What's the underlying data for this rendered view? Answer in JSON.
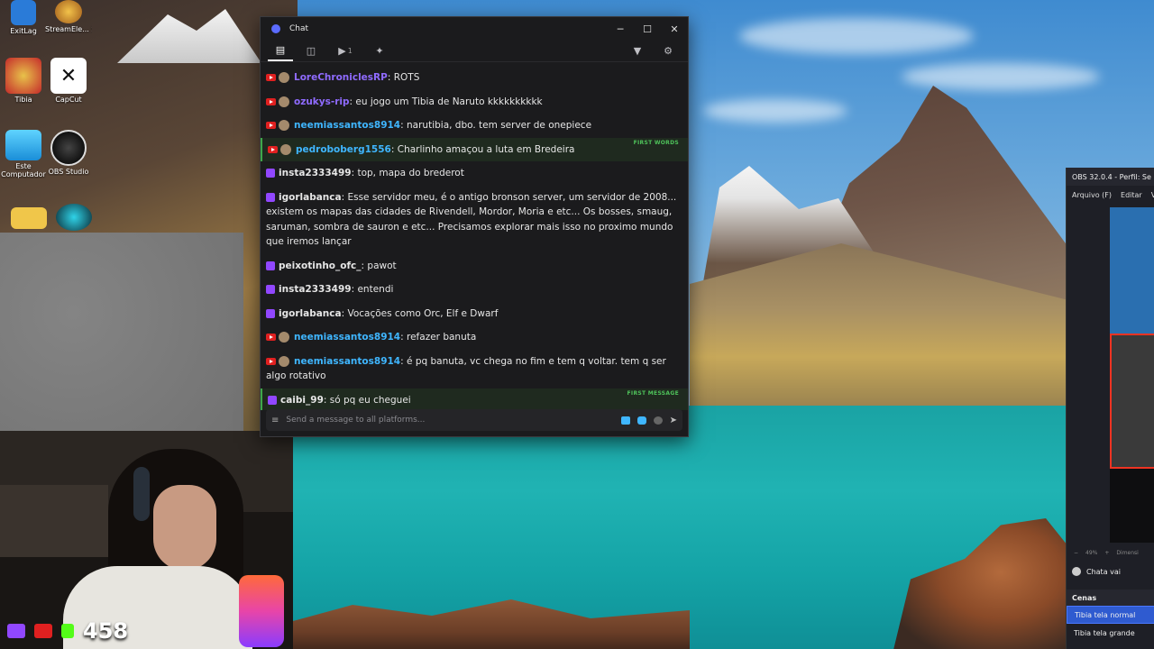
{
  "desktop": {
    "icons": [
      {
        "label": "ExitLag",
        "icon": "exitlag-icon",
        "color": "#2a7bd8"
      },
      {
        "label": "StreamEle... SE.Live",
        "icon": "streamelements-icon",
        "color": "#d88a2a"
      },
      {
        "label": "Tibia",
        "icon": "tibia-icon",
        "color": "#c7a33a"
      },
      {
        "label": "CapCut",
        "icon": "capcut-icon",
        "color": "#ffffff"
      },
      {
        "label": "Este Computador",
        "icon": "computer-icon",
        "color": "#2fb4e8"
      },
      {
        "label": "OBS Studio",
        "icon": "obs-icon",
        "color": "#2a2a2a"
      }
    ]
  },
  "webcam": {
    "viewer_count": "458"
  },
  "chat": {
    "title": "Chat",
    "toolbar": {
      "youtube_count": "1"
    },
    "messages": [
      {
        "platform": "youtube",
        "user": "LoreChroniclesRP",
        "sep": ":",
        "text": "ROTS",
        "color": "#8f6bff",
        "tag": ""
      },
      {
        "platform": "youtube",
        "user": "ozukys-rip",
        "sep": ":",
        "text": "eu jogo um Tibia de Naruto kkkkkkkkkk",
        "color": "#8f6bff",
        "tag": ""
      },
      {
        "platform": "youtube",
        "user": "neemiassantos8914",
        "sep": ":",
        "text": "narutibia, dbo. tem server de onepiece",
        "color": "#3fb6ff",
        "tag": ""
      },
      {
        "platform": "youtube",
        "user": "pedroboberg1556",
        "sep": ":",
        "text": "Charlinho amaçou a luta em Bredeira",
        "color": "#3fb6ff",
        "tag": "FIRST WORDS"
      },
      {
        "platform": "twitch",
        "user": "insta2333499",
        "sep": ":",
        "text": "top, mapa do brederot",
        "color": "#e6e6e6",
        "tag": ""
      },
      {
        "platform": "twitch",
        "user": "igorlabanca",
        "sep": ":",
        "text": "Esse servidor meu, é o antigo bronson server, um servidor de 2008... existem os mapas das cidades de Rivendell, Mordor, Moria e etc... Os bosses, smaug, saruman, sombra de sauron e etc... Precisamos explorar mais isso no proximo mundo que iremos lançar",
        "color": "#e6e6e6",
        "tag": ""
      },
      {
        "platform": "twitch",
        "user": "peixotinho_ofc_",
        "sep": ":",
        "text": "pawot",
        "color": "#e6e6e6",
        "tag": ""
      },
      {
        "platform": "twitch",
        "user": "insta2333499",
        "sep": ":",
        "text": "entendi",
        "color": "#e6e6e6",
        "tag": ""
      },
      {
        "platform": "twitch",
        "user": "igorlabanca",
        "sep": ":",
        "text": "Vocações como Orc, Elf e Dwarf",
        "color": "#e6e6e6",
        "tag": ""
      },
      {
        "platform": "youtube",
        "user": "neemiassantos8914",
        "sep": ":",
        "text": "refazer banuta",
        "color": "#3fb6ff",
        "tag": ""
      },
      {
        "platform": "youtube",
        "user": "neemiassantos8914",
        "sep": ":",
        "text": "é pq banuta, vc chega no fim e tem q voltar. tem q ser algo rotativo",
        "color": "#3fb6ff",
        "tag": ""
      },
      {
        "platform": "twitch",
        "user": "caibi_99",
        "sep": ":",
        "text": "só pq eu cheguei",
        "color": "#e6e6e6",
        "tag": "FIRST MESSAGE"
      }
    ],
    "input": {
      "placeholder": "Send a message to all platforms..."
    }
  },
  "obs": {
    "title": "OBS 32.0.4 - Perfil: Se",
    "menu": [
      "Arquivo (F)",
      "Editar",
      "V"
    ],
    "zoom": "49%",
    "dimension_label": "Dimensi",
    "source_label": "Chata vai",
    "scenes_header": "Cenas",
    "scenes": [
      {
        "label": "Tibia tela normal",
        "selected": true
      },
      {
        "label": "Tibia tela grande",
        "selected": false
      }
    ]
  },
  "colors": {
    "youtube": "#e02020",
    "twitch": "#9147ff",
    "first_tag": "#4ec25a",
    "obs_selection": "#2f5bd0"
  }
}
